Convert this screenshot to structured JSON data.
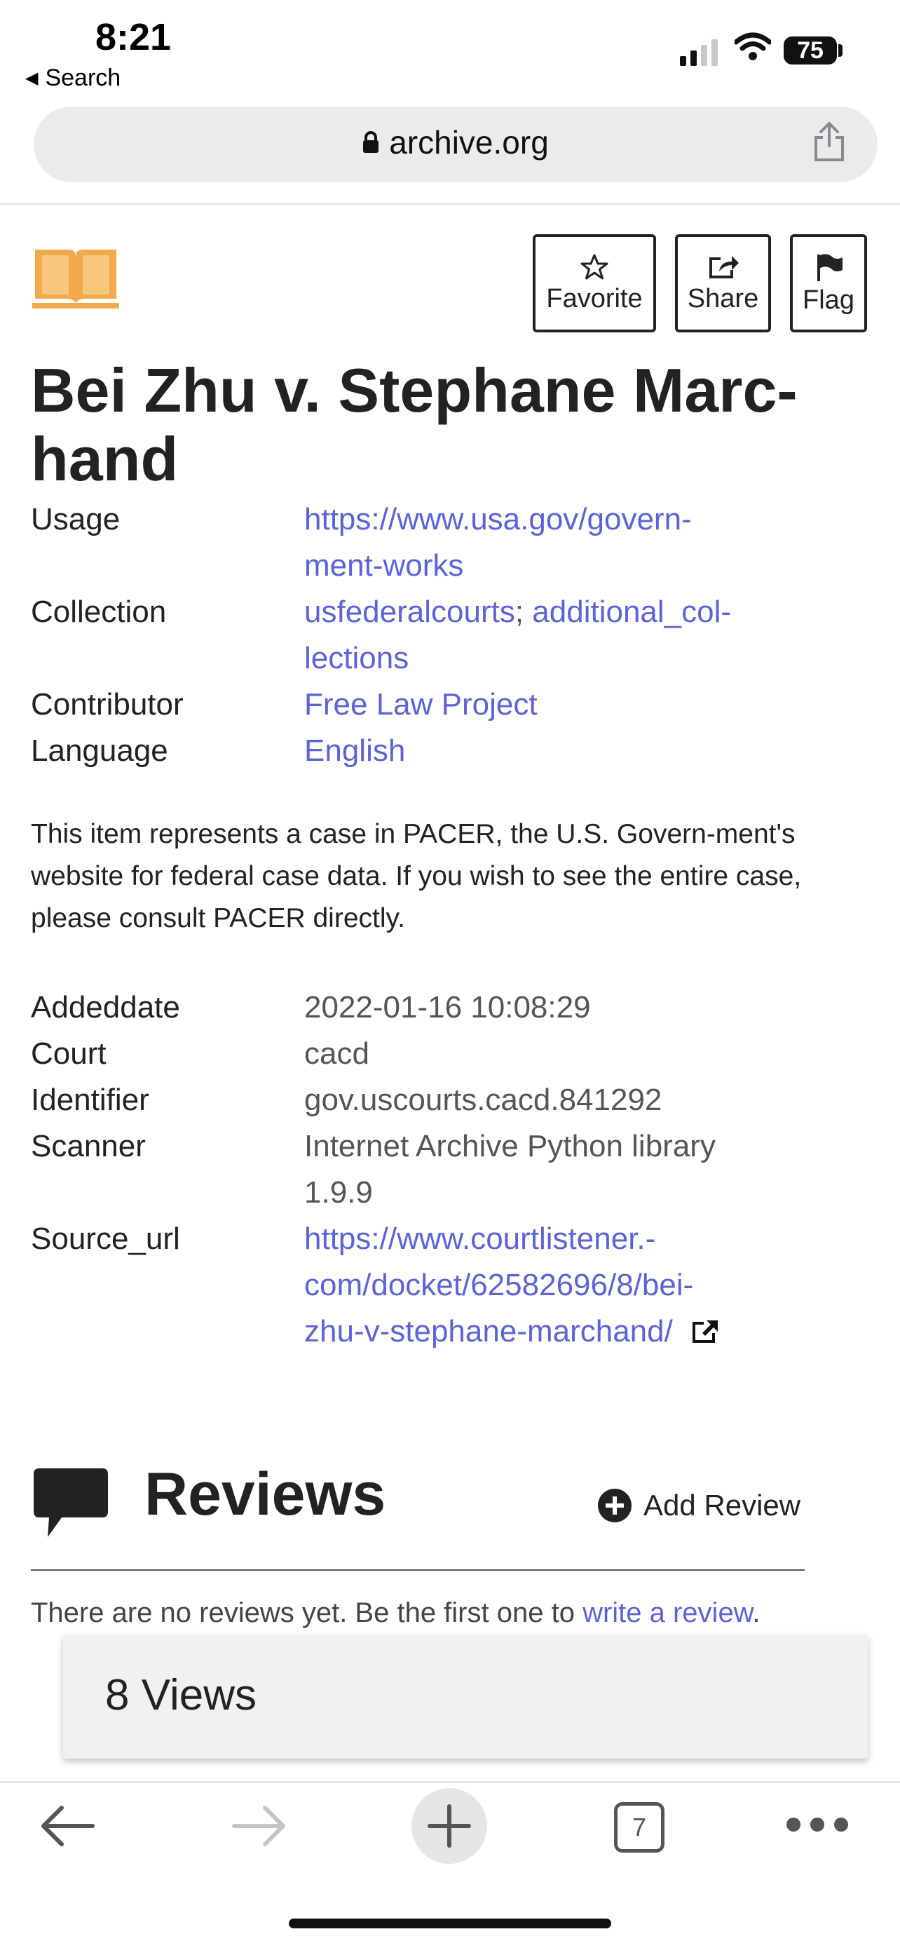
{
  "status_bar": {
    "time": "8:21",
    "back_label": "Search",
    "battery": "75"
  },
  "browser": {
    "url": "archive.org"
  },
  "item": {
    "title_line1": "Bei Zhu v. Stephane Marc-",
    "title_line2": "hand",
    "actions": {
      "favorite": "Favorite",
      "share": "Share",
      "flag": "Flag"
    }
  },
  "metadata": {
    "usage_key": "Usage",
    "usage_val_l1": "https://www.usa.gov/govern-",
    "usage_val_l2": "ment-works",
    "collection_key": "Collection",
    "collection_link1": "usfederalcourts",
    "collection_sep": "; ",
    "collection_link2_l1": "additional_col-",
    "collection_link2_l2": "lections",
    "contributor_key": "Contributor",
    "contributor_val": "Free Law Project",
    "language_key": "Language",
    "language_val": "English"
  },
  "description": "This item represents a case in PACER, the U.S. Govern-ment's website for federal case data. If you wish to see the entire case, please consult PACER directly.",
  "details": {
    "addeddate_key": "Addeddate",
    "addeddate_val": "2022-01-16 10:08:29",
    "court_key": "Court",
    "court_val": "cacd",
    "identifier_key": "Identifier",
    "identifier_val": "gov.uscourts.cacd.841292",
    "scanner_key": "Scanner",
    "scanner_val_l1": "Internet Archive Python library",
    "scanner_val_l2": "1.9.9",
    "source_key": "Source_url",
    "source_val_l1": "https://www.courtlistener.-",
    "source_val_l2": "com/docket/62582696/8/bei-",
    "source_val_l3": "zhu-v-stephane-marchand/"
  },
  "reviews": {
    "title": "Reviews",
    "add_review": "Add Review",
    "empty_text": "There are no reviews yet. Be the first one to ",
    "write_link": "write a review",
    "empty_end": "."
  },
  "views": "8 Views",
  "toolbar": {
    "tab_count": "7"
  },
  "colors": {
    "link": "#5a63d9",
    "book_icon": "#f0a94b"
  }
}
